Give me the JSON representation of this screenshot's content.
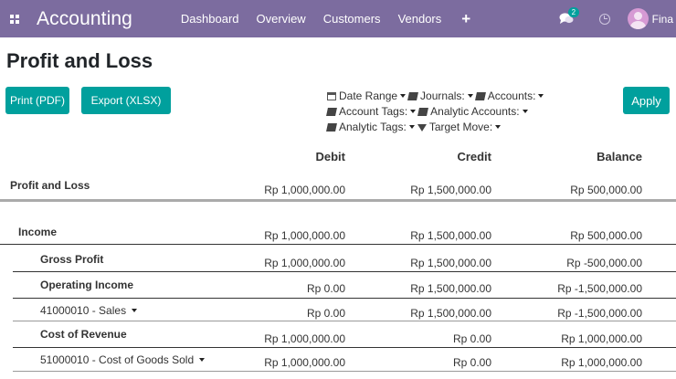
{
  "nav": {
    "brand": "Accounting",
    "menu": [
      "Dashboard",
      "Overview",
      "Customers",
      "Vendors"
    ],
    "plus": "+",
    "chat_badge": "2",
    "user_name": "Fina"
  },
  "page": {
    "title": "Profit and Loss",
    "print_label": "Print (PDF)",
    "export_label": "Export (XLSX)",
    "apply_label": "Apply"
  },
  "filters": {
    "date_range": "Date Range",
    "journals": "Journals:",
    "accounts": "Accounts:",
    "account_tags": "Account Tags:",
    "analytic_accounts": "Analytic Accounts:",
    "analytic_tags": "Analytic Tags:",
    "target_move": "Target Move:"
  },
  "table": {
    "headers": {
      "debit": "Debit",
      "credit": "Credit",
      "balance": "Balance"
    },
    "rows": [
      {
        "label": "Profit and Loss",
        "debit": "Rp 1,000,000.00",
        "credit": "Rp 1,500,000.00",
        "balance": "Rp 500,000.00"
      },
      {
        "label": "Income",
        "debit": "Rp 1,000,000.00",
        "credit": "Rp 1,500,000.00",
        "balance": "Rp 500,000.00"
      },
      {
        "label": "Gross Profit",
        "debit": "Rp 1,000,000.00",
        "credit": "Rp 1,500,000.00",
        "balance": "Rp -500,000.00"
      },
      {
        "label": "Operating Income",
        "debit": "Rp 0.00",
        "credit": "Rp 1,500,000.00",
        "balance": "Rp -1,500,000.00"
      },
      {
        "label": "41000010 - Sales",
        "debit": "Rp 0.00",
        "credit": "Rp 1,500,000.00",
        "balance": "Rp -1,500,000.00"
      },
      {
        "label": "Cost of Revenue",
        "debit": "Rp 1,000,000.00",
        "credit": "Rp 0.00",
        "balance": "Rp 1,000,000.00"
      },
      {
        "label": "51000010 - Cost of Goods Sold",
        "debit": "Rp 1,000,000.00",
        "credit": "Rp 0.00",
        "balance": "Rp 1,000,000.00"
      }
    ]
  },
  "icons": {
    "apps": "apps-grid-icon",
    "chat": "chat-icon",
    "clock": "clock-icon",
    "calendar": "calendar-icon",
    "book": "book-icon",
    "tag": "tag-icon",
    "funnel": "funnel-icon"
  },
  "colors": {
    "navbar": "#7c6c9f",
    "primary_button": "#00a09d",
    "badge": "#00a09d"
  }
}
